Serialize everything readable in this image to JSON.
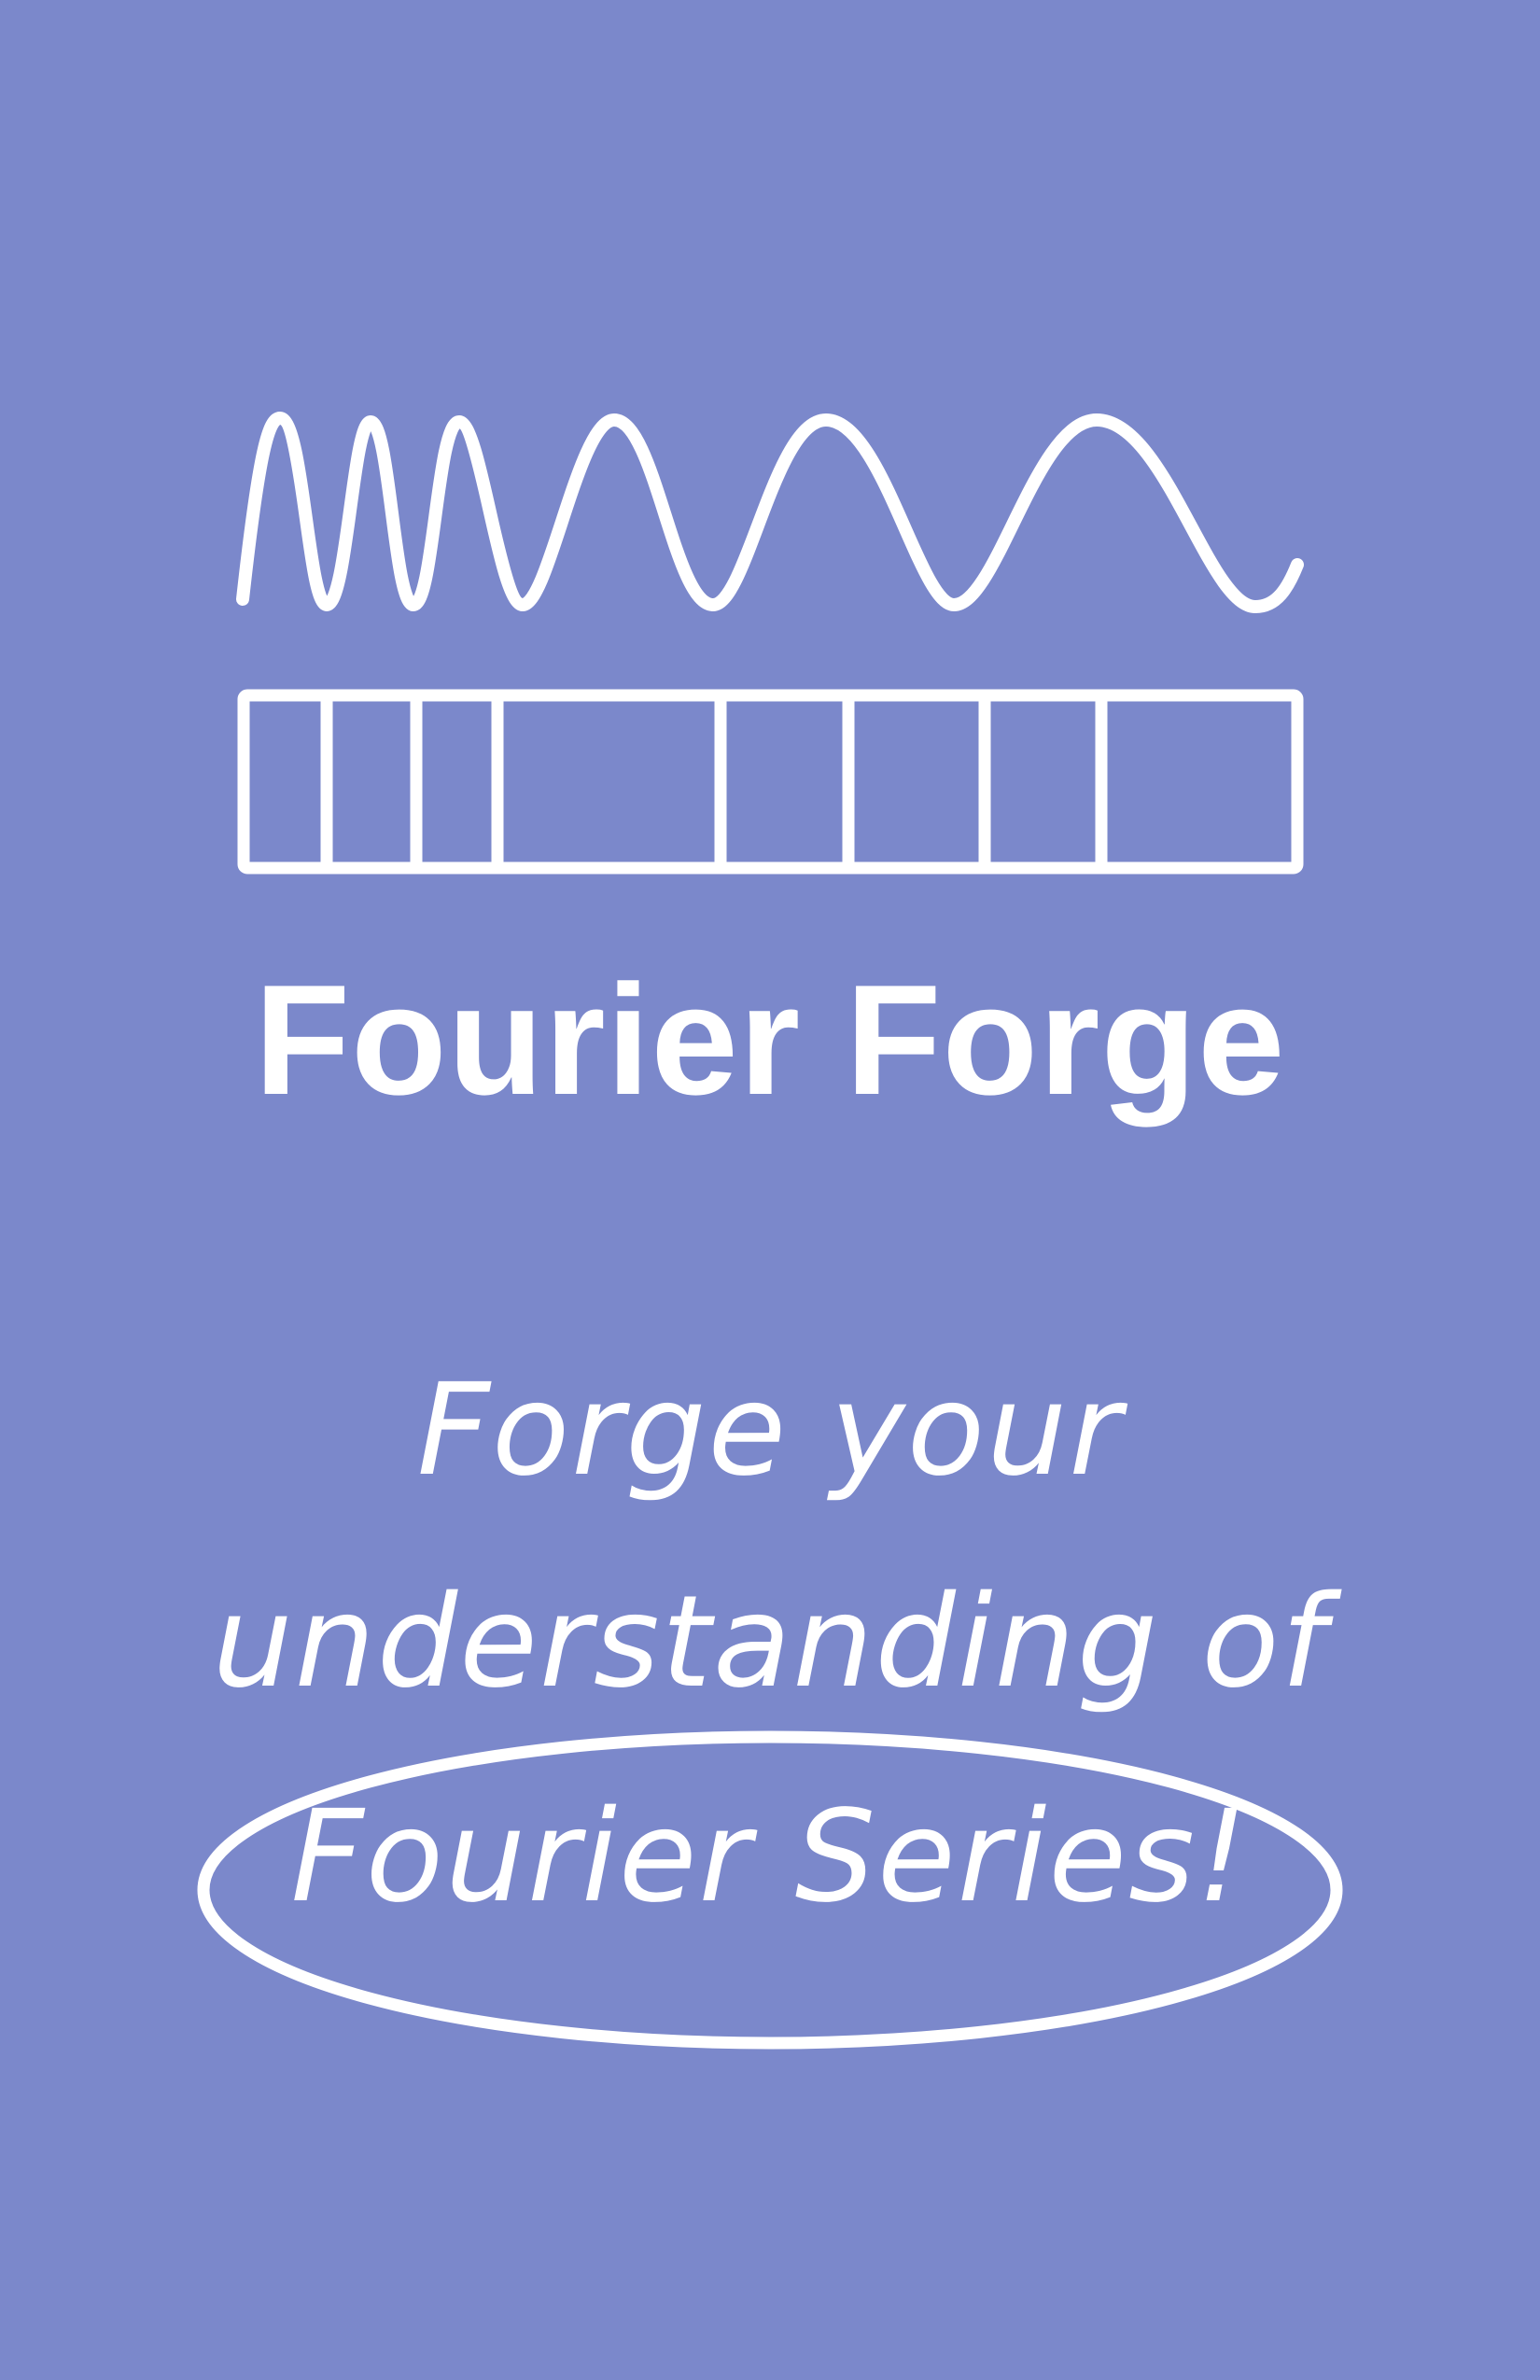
{
  "page": {
    "background": "#7b88cb",
    "foreground": "#ffffff"
  },
  "logo": {
    "icon": "wave-and-bars-icon",
    "title": "Fourier Forge"
  },
  "tagline": {
    "line1": "Forge your",
    "line2": "understanding of",
    "line3": "Fourier Series!"
  }
}
